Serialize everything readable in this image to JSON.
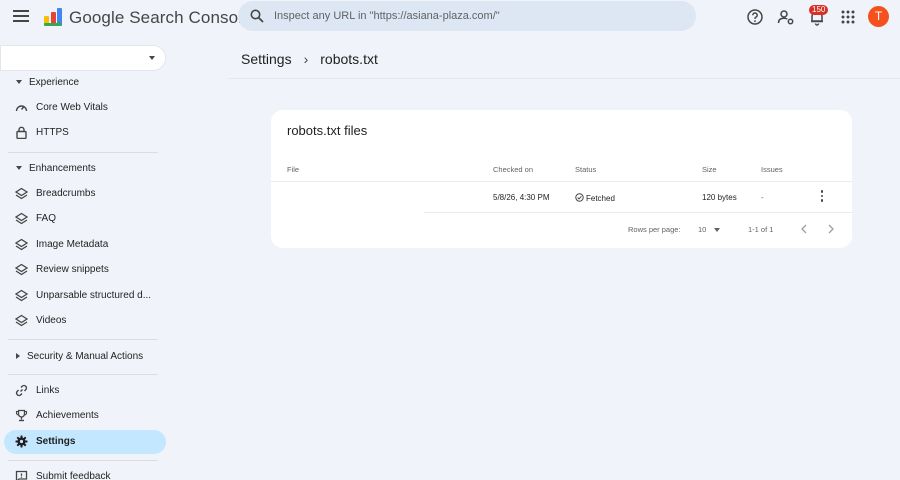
{
  "header": {
    "app_name": "Google Search Console",
    "search_placeholder": "Inspect any URL in \"https://asiana-plaza.com/\"",
    "notification_count": "150",
    "avatar_initial": "T",
    "icons": [
      "menu-icon",
      "search-console-logo",
      "search-icon",
      "help-icon",
      "manage-users-icon",
      "notifications-icon",
      "apps-icon"
    ]
  },
  "sidebar": {
    "property": "",
    "sections": {
      "experience": "Experience",
      "enhancements": "Enhancements",
      "security": "Security & Manual Actions"
    },
    "items": {
      "core_web_vitals": "Core Web Vitals",
      "https": "HTTPS",
      "breadcrumbs": "Breadcrumbs",
      "faq": "FAQ",
      "image_metadata": "Image Metadata",
      "review_snippets": "Review snippets",
      "unparsable": "Unparsable structured d...",
      "videos": "Videos",
      "links": "Links",
      "achievements": "Achievements",
      "settings": "Settings",
      "submit_feedback": "Submit feedback"
    },
    "active_item": "Settings"
  },
  "breadcrumb": {
    "parent": "Settings",
    "current": "robots.txt"
  },
  "card": {
    "title": "robots.txt files",
    "columns": [
      "File",
      "Checked on",
      "Status",
      "Size",
      "Issues"
    ],
    "rows": [
      {
        "file": "",
        "checked_on": "5/8/26, 4:30 PM",
        "status": "Fetched",
        "size": "120 bytes",
        "issues": "-"
      }
    ],
    "pagination": {
      "rows_per_page_label": "Rows per page:",
      "rows_per_page": "10",
      "range": "1-1 of 1"
    }
  },
  "colors": {
    "background": "#f0f4fa",
    "active_nav": "#c2e7ff",
    "avatar": "#f4511e",
    "badge": "#d93025",
    "status_ok": "#444746"
  }
}
